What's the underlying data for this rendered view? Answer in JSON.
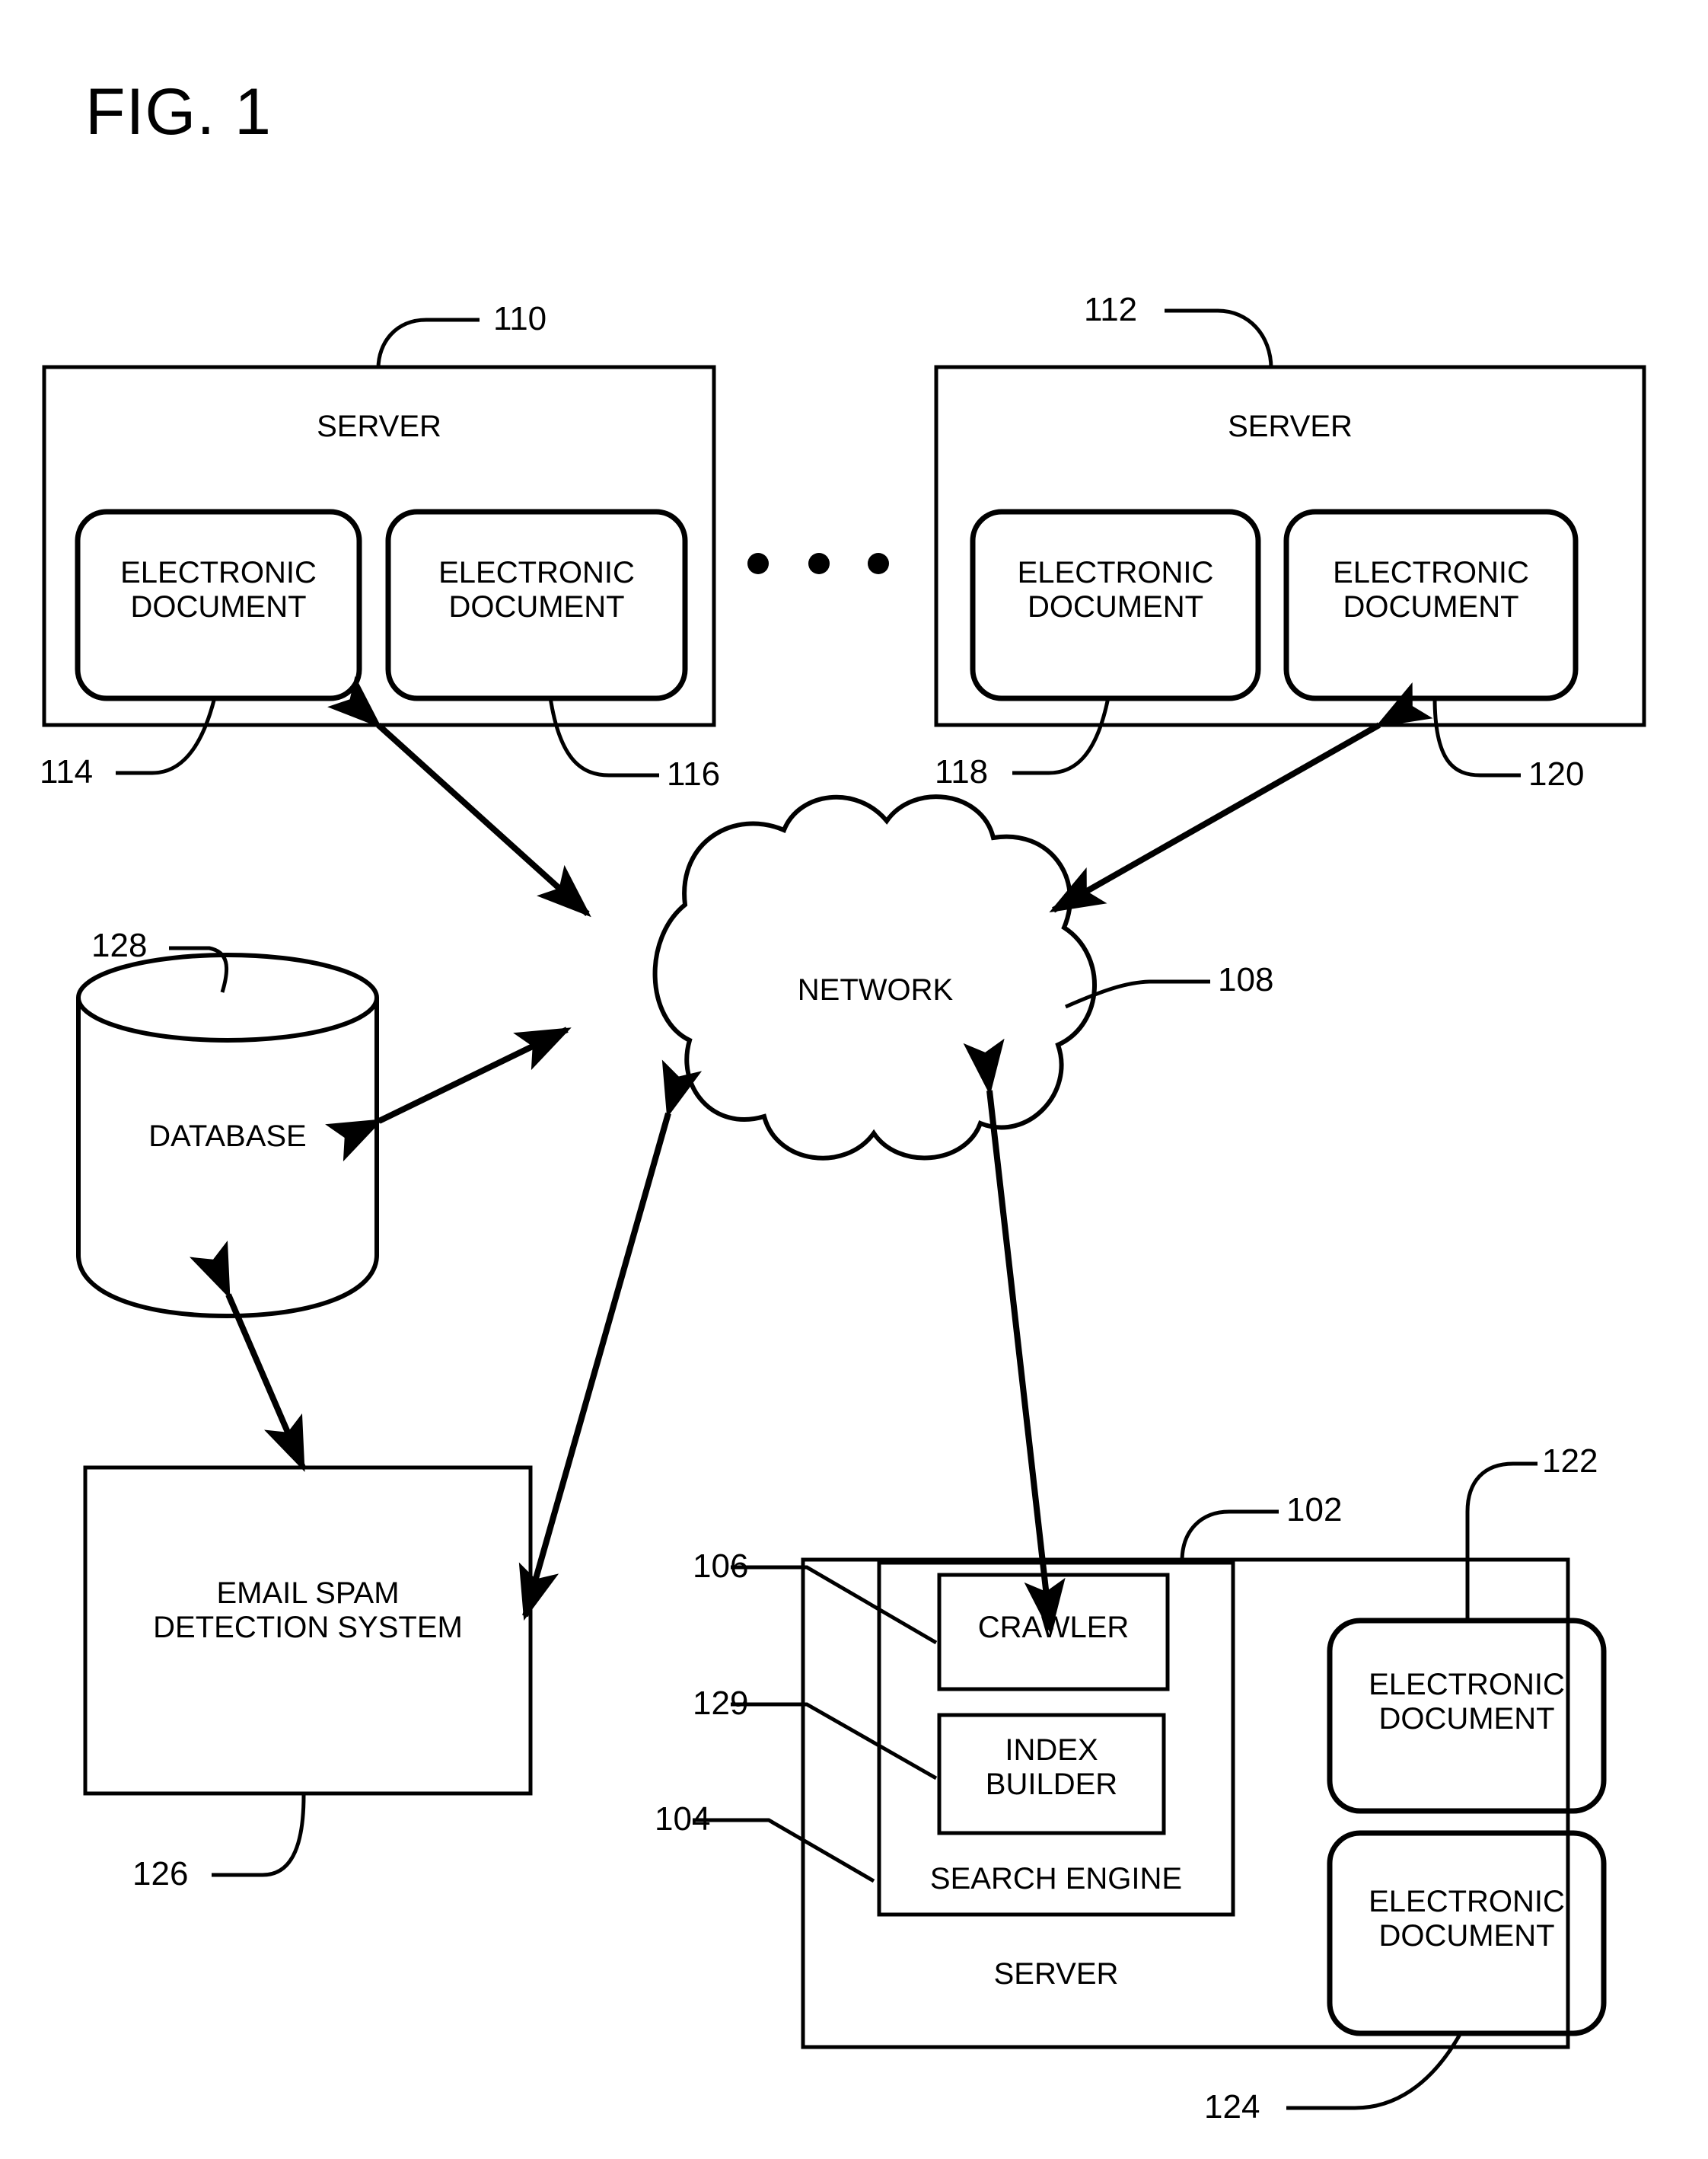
{
  "figure": {
    "title": "FIG. 1"
  },
  "nodes": {
    "server_110": {
      "title": "SERVER",
      "documents": [
        {
          "label": "ELECTRONIC\nDOCUMENT"
        },
        {
          "label": "ELECTRONIC\nDOCUMENT"
        }
      ]
    },
    "server_112": {
      "title": "SERVER",
      "documents": [
        {
          "label": "ELECTRONIC\nDOCUMENT"
        },
        {
          "label": "ELECTRONIC\nDOCUMENT"
        }
      ]
    },
    "network": {
      "label": "NETWORK"
    },
    "database": {
      "label": "DATABASE"
    },
    "email_spam_detection_system": {
      "label": "EMAIL SPAM\nDETECTION SYSTEM"
    },
    "server_102": {
      "title": "SERVER",
      "search_engine": {
        "label": "SEARCH ENGINE",
        "crawler": {
          "label": "CRAWLER"
        },
        "index_builder": {
          "label": "INDEX\nBUILDER"
        }
      },
      "documents": [
        {
          "label": "ELECTRONIC\nDOCUMENT"
        },
        {
          "label": "ELECTRONIC\nDOCUMENT"
        }
      ]
    },
    "ellipsis": "three-dots"
  },
  "reference_numerals": {
    "n102": "102",
    "n104": "104",
    "n106": "106",
    "n108": "108",
    "n110": "110",
    "n112": "112",
    "n114": "114",
    "n116": "116",
    "n118": "118",
    "n120": "120",
    "n122": "122",
    "n124": "124",
    "n126": "126",
    "n128": "128",
    "n129": "129"
  },
  "style": {
    "stroke": "#000000",
    "background": "#ffffff"
  }
}
